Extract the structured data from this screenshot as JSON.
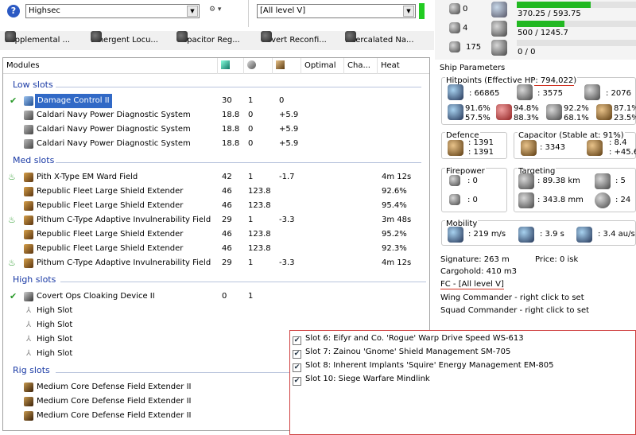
{
  "top_bar": {
    "profile_select": "Highsec",
    "skills_select": "[All level V]"
  },
  "tabs": [
    {
      "label": "Supplemental ..."
    },
    {
      "label": "Emergent Locu..."
    },
    {
      "label": "Capacitor Reg..."
    },
    {
      "label": "Covert Reconfi..."
    },
    {
      "label": "Intercalated Na..."
    }
  ],
  "modules_table": {
    "headers": {
      "modules": "Modules",
      "optimal": "Optimal",
      "charge": "Cha...",
      "heat": "Heat"
    },
    "sections": [
      {
        "title": "Low slots",
        "rows": [
          {
            "name": "Damage Control II",
            "c1": "30",
            "c2": "1",
            "c3": "0",
            "heat": ""
          },
          {
            "name": "Caldari Navy Power Diagnostic System",
            "c1": "18.8",
            "c2": "0",
            "c3": "+5.9",
            "heat": ""
          },
          {
            "name": "Caldari Navy Power Diagnostic System",
            "c1": "18.8",
            "c2": "0",
            "c3": "+5.9",
            "heat": ""
          },
          {
            "name": "Caldari Navy Power Diagnostic System",
            "c1": "18.8",
            "c2": "0",
            "c3": "+5.9",
            "heat": ""
          }
        ]
      },
      {
        "title": "Med slots",
        "rows": [
          {
            "name": "Pith X-Type EM Ward Field",
            "c1": "42",
            "c2": "1",
            "c3": "-1.7",
            "heat": "4m 12s"
          },
          {
            "name": "Republic Fleet Large Shield Extender",
            "c1": "46",
            "c2": "123.8",
            "c3": "",
            "heat": "92.6%"
          },
          {
            "name": "Republic Fleet Large Shield Extender",
            "c1": "46",
            "c2": "123.8",
            "c3": "",
            "heat": "95.4%"
          },
          {
            "name": "Pithum C-Type Adaptive Invulnerability Field",
            "c1": "29",
            "c2": "1",
            "c3": "-3.3",
            "heat": "3m 48s"
          },
          {
            "name": "Republic Fleet Large Shield Extender",
            "c1": "46",
            "c2": "123.8",
            "c3": "",
            "heat": "95.2%"
          },
          {
            "name": "Republic Fleet Large Shield Extender",
            "c1": "46",
            "c2": "123.8",
            "c3": "",
            "heat": "92.3%"
          },
          {
            "name": "Pithum C-Type Adaptive Invulnerability Field",
            "c1": "29",
            "c2": "1",
            "c3": "-3.3",
            "heat": "4m 12s"
          }
        ]
      },
      {
        "title": "High slots",
        "rows": [
          {
            "name": "Covert Ops Cloaking Device II",
            "c1": "0",
            "c2": "1",
            "c3": "",
            "heat": ""
          },
          {
            "name": "High Slot",
            "c1": "",
            "c2": "",
            "c3": "",
            "heat": ""
          },
          {
            "name": "High Slot",
            "c1": "",
            "c2": "",
            "c3": "",
            "heat": ""
          },
          {
            "name": "High Slot",
            "c1": "",
            "c2": "",
            "c3": "",
            "heat": ""
          },
          {
            "name": "High Slot",
            "c1": "",
            "c2": "",
            "c3": "",
            "heat": ""
          }
        ]
      },
      {
        "title": "Rig slots",
        "rows": [
          {
            "name": "Medium Core Defense Field Extender II",
            "c1": "",
            "c2": "",
            "c3": "",
            "heat": ""
          },
          {
            "name": "Medium Core Defense Field Extender II",
            "c1": "",
            "c2": "",
            "c3": "",
            "heat": ""
          },
          {
            "name": "Medium Core Defense Field Extender II",
            "c1": "",
            "c2": "",
            "c3": "",
            "heat": ""
          }
        ]
      }
    ]
  },
  "resources": {
    "hardpoints_turret": "0",
    "hardpoints_launcher": "4",
    "calibration": "175",
    "cpu": "370.25 / 593.75",
    "cpu_fraction": 0.62,
    "powergrid": "500 / 1245.7",
    "powergrid_fraction": 0.4,
    "drone_bay": "0 / 0",
    "drone_fraction": 0.0
  },
  "ship_parameters": {
    "title": "Ship Parameters",
    "hitpoints_label": "Hitpoints (Effective HP: 794,022)",
    "shield_hp": ": 66865",
    "armor_hp": ": 3575",
    "hull_hp": ": 2076",
    "resists": [
      {
        "a": "91.6%",
        "b": "57.5%"
      },
      {
        "a": "94.8%",
        "b": "88.3%"
      },
      {
        "a": "92.2%",
        "b": "68.1%"
      },
      {
        "a": "87.1%",
        "b": "23.5%"
      }
    ],
    "defence_title": "Defence",
    "defence_a": ": 1391",
    "defence_b": ": 1391",
    "capacitor_title": "Capacitor (Stable at: 91%)",
    "cap_amount": ": 3343",
    "cap_a": ": 8.4",
    "cap_b": ": +45.6",
    "firepower_title": "Firepower",
    "fire_a": ": 0",
    "fire_b": ": 0",
    "targeting_title": "Targeting",
    "target_range": ": 89.38 km",
    "scan_res": ": 343.8 mm",
    "max_targets": ": 5",
    "sensor_str": ": 24",
    "mobility_title": "Mobility",
    "velocity": ": 219 m/s",
    "align_time": ": 3.9 s",
    "warp_speed": ": 3.4 au/s",
    "signature": "Signature: 263 m",
    "price": "Price: 0 isk",
    "cargohold": "Cargohold: 410 m3",
    "fc": "FC - [All level V]",
    "wing_commander": "Wing Commander - right click to set",
    "squad_commander": "Squad Commander - right click to set"
  },
  "implants": [
    {
      "label": "Slot 6: Eifyr and Co. 'Rogue' Warp Drive Speed WS-613"
    },
    {
      "label": "Slot 7: Zainou 'Gnome' Shield Management SM-705"
    },
    {
      "label": "Slot 8: Inherent Implants 'Squire' Energy Management EM-805"
    },
    {
      "label": "Slot 10: Siege Warfare Mindlink"
    }
  ]
}
